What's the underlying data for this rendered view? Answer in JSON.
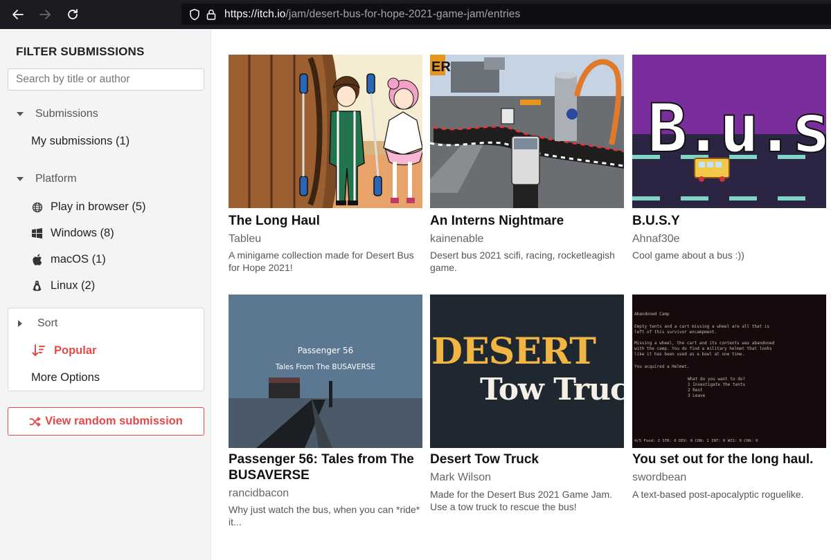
{
  "browser": {
    "url_host": "https://itch.io",
    "url_path": "/jam/desert-bus-for-hope-2021-game-jam/entries"
  },
  "sidebar": {
    "title": "FILTER SUBMISSIONS",
    "search_placeholder": "Search by title or author",
    "submissions": {
      "heading": "Submissions",
      "items": [
        {
          "label": "My submissions (1)"
        }
      ]
    },
    "platform": {
      "heading": "Platform",
      "items": [
        {
          "label": "Play in browser (5)",
          "icon": "globe-icon"
        },
        {
          "label": "Windows (8)",
          "icon": "windows-icon"
        },
        {
          "label": "macOS (1)",
          "icon": "apple-icon"
        },
        {
          "label": "Linux (2)",
          "icon": "linux-icon"
        }
      ]
    },
    "sort": {
      "heading": "Sort",
      "selected": "Popular",
      "more_options": "More Options"
    },
    "random_button": "View random submission"
  },
  "games": [
    {
      "title": "The Long Haul",
      "author": "Tableu",
      "description": "A minigame collection made for Desert Bus for Hope 2021!"
    },
    {
      "title": "An Interns Nightmare",
      "author": "kainenable",
      "description": "Desert bus 2021 scifi, racing, rocketleagish game."
    },
    {
      "title": "B.U.S.Y",
      "author": "Ahnaf30e",
      "description": "Cool game about a bus :))"
    },
    {
      "title": "Passenger 56: Tales from The BUSAVERSE",
      "author": "rancidbacon",
      "description": "Why just watch the bus, when you can *ride* it..."
    },
    {
      "title": "Desert Tow Truck",
      "author": "Mark Wilson",
      "description": "Made for the Desert Bus 2021 Game Jam. Use a tow truck to rescue the bus!"
    },
    {
      "title": "You set out for the long haul.",
      "author": "swordbean",
      "description": "A text-based post-apocalyptic roguelike."
    }
  ],
  "thumb_text": {
    "interns_sign": "ER",
    "passenger_title": "Passenger 56",
    "passenger_subtitle": "Tales From The BUSAVERSE",
    "busy_logo": "B.u.s.y",
    "tow_line1": "DESERT",
    "tow_line2": "Tow Truck",
    "terminal": {
      "heading": "Abandoned Camp",
      "lines": [
        "Empty tents and a cart missing a wheel are all that is",
        "left of this survivor encampment.",
        "",
        "Missing a wheel, the cart and its contents was abandoned",
        "with the camp. You do find a military helmet that looks",
        "like it has been used as a bowl at one time.",
        "",
        "You acquired a Helmet."
      ],
      "prompt": "What do you want to do?",
      "options": [
        "1 Investigate the tents",
        "2 Rest",
        "3 Leave"
      ],
      "status": "4/5  Food: 2   STR: 0   DEX: 0   CON: 1   INT: 0   WIS: 0   CHA: 0"
    }
  },
  "colors": {
    "accent": "#e64848",
    "browser_bg": "#1c1b22",
    "sidebar_bg": "#f4f4f4"
  }
}
